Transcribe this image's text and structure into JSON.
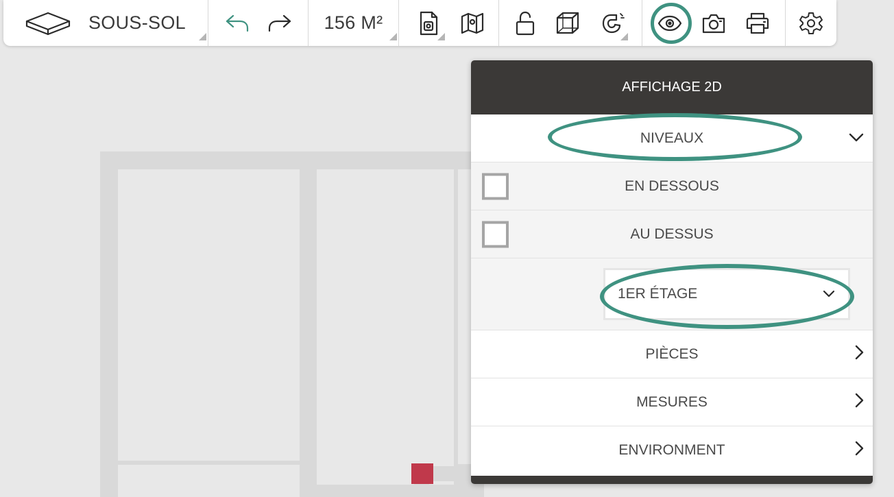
{
  "toolbar": {
    "level_label": "SOUS-SOL",
    "area_label": "156 M²",
    "icons": {
      "level": "floor-box-icon",
      "undo": "undo-icon",
      "redo": "redo-icon",
      "document": "document-icon",
      "map": "map-icon",
      "lock": "unlock-icon",
      "cube": "cube-icon",
      "magnet": "magnet-icon",
      "eye": "eye-icon",
      "camera": "camera-icon",
      "print": "printer-icon",
      "settings": "gear-icon"
    }
  },
  "panel": {
    "title": "AFFICHAGE 2D",
    "levels_label": "NIVEAUX",
    "below_label": "EN DESSOUS",
    "above_label": "AU DESSUS",
    "floor_select_value": "1ER ÉTAGE",
    "rooms_label": "PIÈCES",
    "measures_label": "MESURES",
    "environment_label": "ENVIRONMENT"
  },
  "colors": {
    "accent": "#3f9281",
    "panel_header": "#3b3937",
    "marker": "#c0394b"
  }
}
